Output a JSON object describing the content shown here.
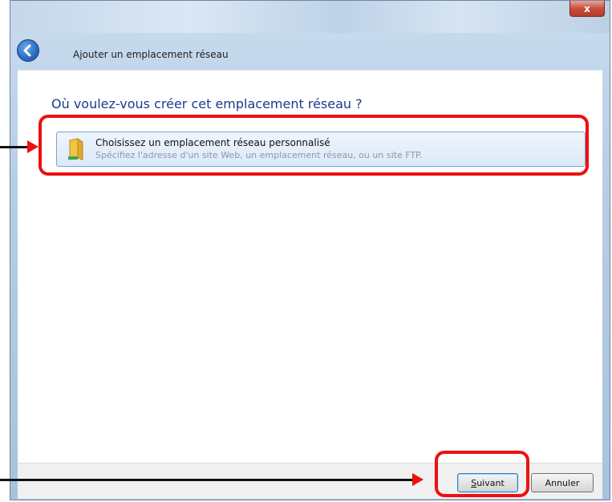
{
  "window": {
    "close_label": "x",
    "wizard_title": "Ajouter un emplacement réseau"
  },
  "content": {
    "heading": "Où voulez-vous créer cet emplacement réseau ?",
    "option": {
      "title": "Choisissez un emplacement réseau personnalisé",
      "description": "Spécifiez l'adresse d'un site Web, un emplacement réseau, ou un site FTP."
    }
  },
  "footer": {
    "next_label_hotkey": "S",
    "next_label_rest": "uivant",
    "cancel_label": "Annuler"
  },
  "colors": {
    "annotation_red": "#ee1010",
    "heading_blue": "#1e3a8a"
  },
  "icons": {
    "back": "back-arrow-icon",
    "option": "network-folder-icon"
  }
}
